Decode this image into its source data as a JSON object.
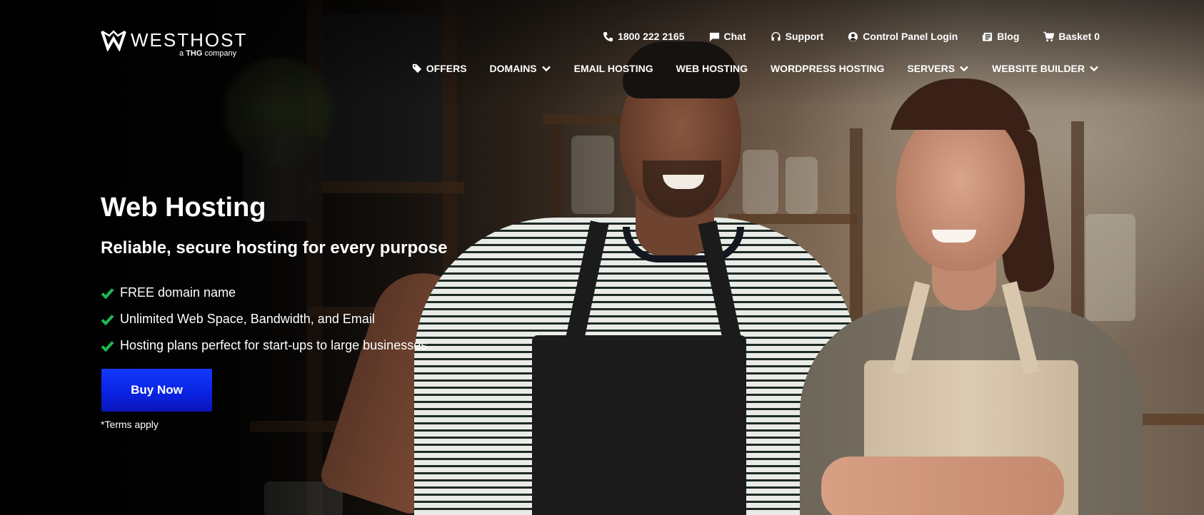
{
  "brand": {
    "name": "WESTHOST",
    "tagline_prefix": "a",
    "tagline_brand": "THG",
    "tagline_suffix": "company"
  },
  "utility_nav": [
    {
      "icon": "phone-icon",
      "label": "1800 222 2165"
    },
    {
      "icon": "chat-icon",
      "label": "Chat"
    },
    {
      "icon": "headset-icon",
      "label": "Support"
    },
    {
      "icon": "user-icon",
      "label": "Control Panel Login"
    },
    {
      "icon": "blog-icon",
      "label": "Blog"
    },
    {
      "icon": "cart-icon",
      "label": "Basket 0"
    }
  ],
  "main_nav": [
    {
      "label": "OFFERS",
      "icon": "tag-icon"
    },
    {
      "label": "DOMAINS",
      "dropdown": true
    },
    {
      "label": "EMAIL HOSTING"
    },
    {
      "label": "WEB HOSTING"
    },
    {
      "label": "WORDPRESS HOSTING"
    },
    {
      "label": "SERVERS",
      "dropdown": true
    },
    {
      "label": "WEBSITE BUILDER",
      "dropdown": true
    }
  ],
  "hero": {
    "title": "Web Hosting",
    "subtitle": "Reliable, secure hosting for every purpose",
    "features": [
      "FREE domain name",
      "Unlimited Web Space, Bandwidth, and Email",
      "Hosting plans perfect for start-ups to large businesses"
    ],
    "cta_label": "Buy Now",
    "terms": "*Terms apply"
  },
  "colors": {
    "cta": "#0a22e0",
    "check": "#1db954",
    "text": "#ffffff"
  }
}
